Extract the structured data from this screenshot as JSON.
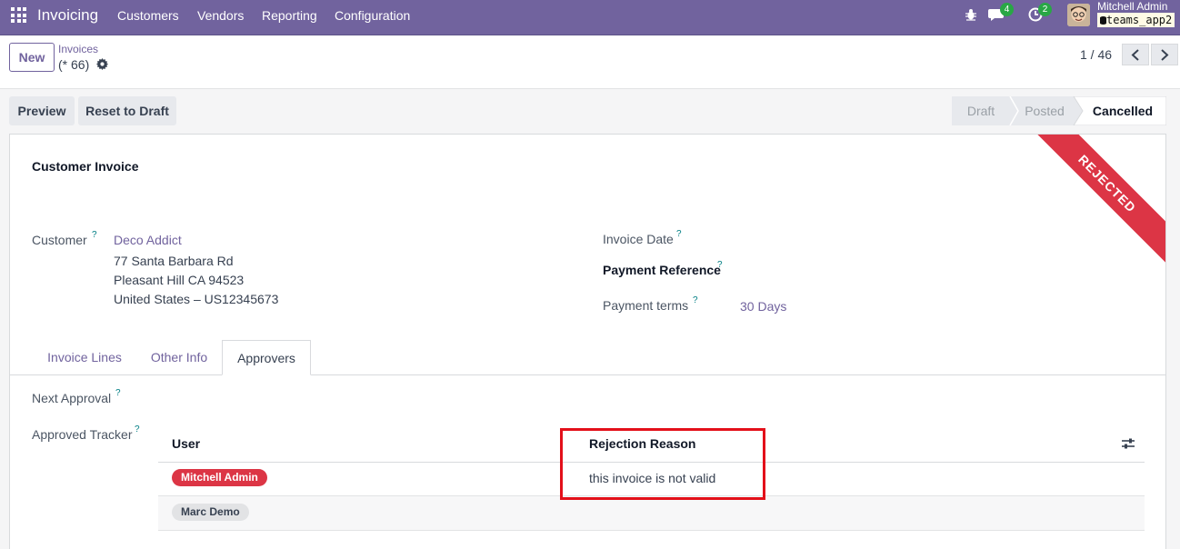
{
  "navbar": {
    "brand": "Invoicing",
    "menu": [
      "Customers",
      "Vendors",
      "Reporting",
      "Configuration"
    ],
    "messages_count": "4",
    "activities_count": "2",
    "user_name": "Mitchell Admin",
    "database": "teams_app2"
  },
  "control": {
    "new_label": "New",
    "breadcrumb": "Invoices",
    "record_count": "(* 66)",
    "pager": "1 / 46"
  },
  "actions": {
    "preview": "Preview",
    "reset": "Reset to Draft"
  },
  "statusbar": [
    "Draft",
    "Posted",
    "Cancelled"
  ],
  "sheet": {
    "ribbon": "REJECTED",
    "title": "Customer Invoice",
    "customer_label": "Customer",
    "customer_name": "Deco Addict",
    "address": [
      "77 Santa Barbara Rd",
      "Pleasant Hill CA 94523",
      "United States – US12345673"
    ],
    "invoice_date_label": "Invoice Date",
    "payment_ref_label": "Payment Reference",
    "payment_terms_label": "Payment terms",
    "payment_terms_value": "30 Days",
    "help_mark": "?"
  },
  "tabs": [
    "Invoice Lines",
    "Other Info",
    "Approvers"
  ],
  "approvers": {
    "next_approval_label": "Next Approval",
    "tracker_label": "Approved Tracker",
    "columns": [
      "User",
      "Rejection Reason"
    ],
    "rows": [
      {
        "user": "Mitchell Admin",
        "reason": "this invoice is not valid"
      },
      {
        "user": "Marc Demo",
        "reason": ""
      }
    ]
  },
  "colors": {
    "brand": "#71639e",
    "danger": "#dc3545",
    "badge": "#28a745",
    "highlight": "#e3101a"
  }
}
